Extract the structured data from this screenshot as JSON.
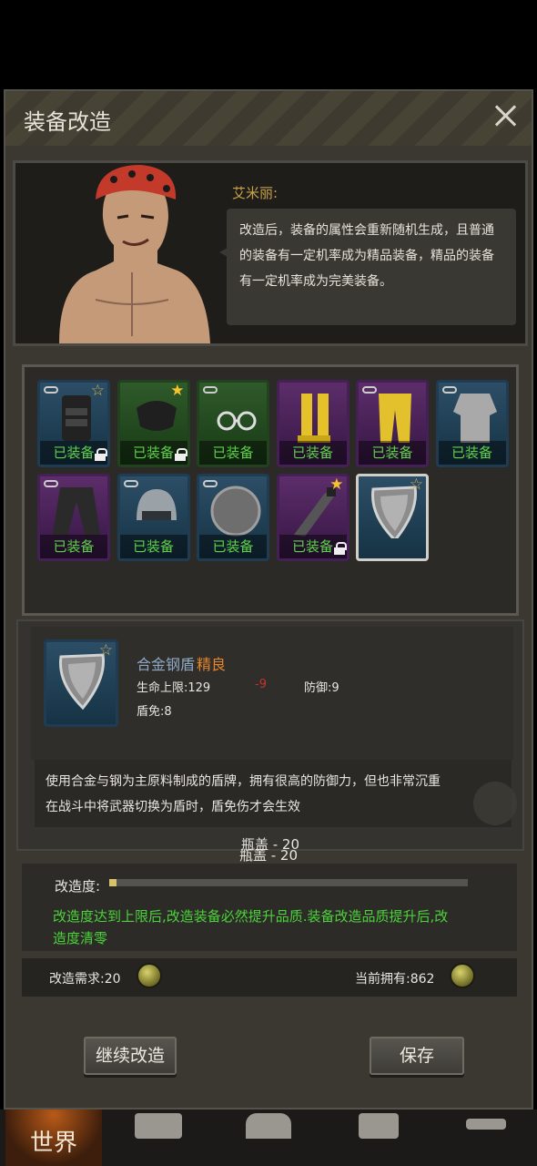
{
  "dialog": {
    "title": "装备改造"
  },
  "npc": {
    "name": "艾米丽:",
    "speech": "改造后，装备的属性会重新随机生成，且普通的装备有一定机率成为精品装备，精品的装备有一定机率成为完美装备。"
  },
  "inventory": {
    "items": [
      {
        "icon": "tactical-vest-icon",
        "rarity": "blue",
        "label": "已装备",
        "linked": true,
        "star": "hollow",
        "locked": true
      },
      {
        "icon": "backpack-icon",
        "rarity": "green",
        "label": "已装备",
        "linked": false,
        "star": "filled",
        "locked": true
      },
      {
        "icon": "glasses-icon",
        "rarity": "green",
        "label": "已装备",
        "linked": true,
        "star": "",
        "locked": false
      },
      {
        "icon": "boots-icon",
        "rarity": "purple",
        "label": "已装备",
        "linked": false,
        "star": "",
        "locked": false
      },
      {
        "icon": "pants-icon",
        "rarity": "purple",
        "label": "已装备",
        "linked": true,
        "star": "",
        "locked": false
      },
      {
        "icon": "shirt-icon",
        "rarity": "blue",
        "label": "已装备",
        "linked": true,
        "star": "",
        "locked": false
      },
      {
        "icon": "jacket-icon",
        "rarity": "purple",
        "label": "已装备",
        "linked": true,
        "star": "",
        "locked": false
      },
      {
        "icon": "helmet-icon",
        "rarity": "blue",
        "label": "已装备",
        "linked": true,
        "star": "",
        "locked": false
      },
      {
        "icon": "round-shield-icon",
        "rarity": "blue",
        "label": "已装备",
        "linked": true,
        "star": "",
        "locked": false
      },
      {
        "icon": "machete-icon",
        "rarity": "purple",
        "label": "已装备",
        "linked": false,
        "star": "filled",
        "locked": true
      },
      {
        "icon": "kite-shield-icon",
        "rarity": "blue",
        "label": "",
        "linked": false,
        "star": "hollow",
        "locked": false,
        "selected": true
      }
    ]
  },
  "detail": {
    "item_icon": "kite-shield-icon",
    "item_name": "合金钢盾",
    "grade": "精良",
    "stats": {
      "hp_label": "生命上限:129",
      "hp_diff": "-9",
      "defense_label": "防御:9",
      "shield_label": "盾免:8"
    },
    "cost_top": "瓶盖 - 20",
    "description_line1": "使用合金与钢为主原料制成的盾牌，拥有很高的防御力，但也非常沉重",
    "description_line2": "在战斗中将武器切换为盾时，盾免伤才会生效",
    "cost_bottom": "瓶盖 - 20"
  },
  "progress": {
    "label": "改造度:",
    "fill_fraction": 0.02,
    "note": "改造度达到上限后,改造装备必然提升品质.装备改造品质提升后,改造度清零"
  },
  "requirement": {
    "need_label": "改造需求:20",
    "own_label": "当前拥有:862"
  },
  "buttons": {
    "continue": "继续改造",
    "save": "保存"
  },
  "nav": {
    "world": "世界"
  },
  "colors": {
    "equipped_green": "#5fd24a",
    "grade_orange": "#e6842a",
    "note_green": "#4cd23a",
    "negative_red": "#c8322a"
  }
}
